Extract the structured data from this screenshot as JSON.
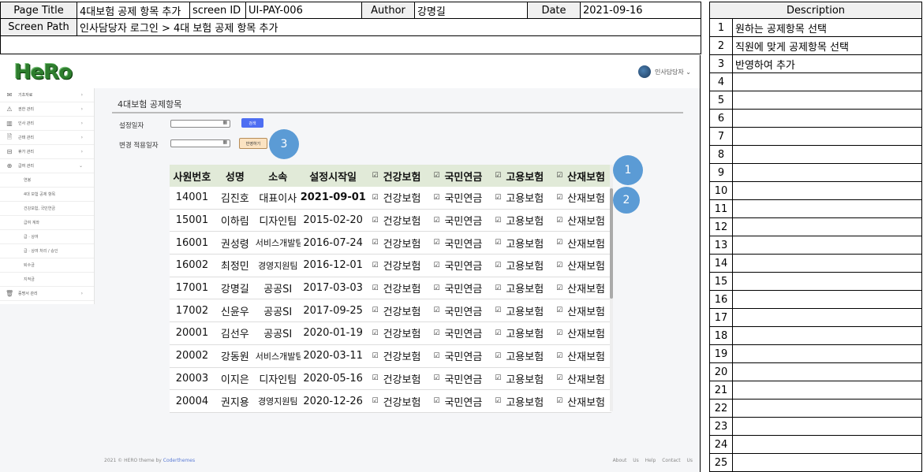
{
  "spec": {
    "page_title_label": "Page Title",
    "page_title": "4대보험 공제 항목 추가",
    "screen_id_label": "screen ID",
    "screen_id": "UI-PAY-006",
    "author_label": "Author",
    "author": "강명길",
    "date_label": "Date",
    "date": "2021-09-16",
    "screen_path_label": "Screen Path",
    "screen_path": "인사담당자 로그인 > 4대 보험 공제 항목 추가"
  },
  "description": {
    "title": "Description",
    "rows": [
      {
        "num": "1",
        "text": "원하는 공제항목 선택"
      },
      {
        "num": "2",
        "text": "직원에 맞게 공제항목 선택"
      },
      {
        "num": "3",
        "text": "반영하여 추가"
      },
      {
        "num": "4",
        "text": ""
      },
      {
        "num": "5",
        "text": ""
      },
      {
        "num": "6",
        "text": ""
      },
      {
        "num": "7",
        "text": ""
      },
      {
        "num": "8",
        "text": ""
      },
      {
        "num": "9",
        "text": ""
      },
      {
        "num": "10",
        "text": ""
      },
      {
        "num": "11",
        "text": ""
      },
      {
        "num": "12",
        "text": ""
      },
      {
        "num": "13",
        "text": ""
      },
      {
        "num": "14",
        "text": ""
      },
      {
        "num": "15",
        "text": ""
      },
      {
        "num": "16",
        "text": ""
      },
      {
        "num": "17",
        "text": ""
      },
      {
        "num": "18",
        "text": ""
      },
      {
        "num": "19",
        "text": ""
      },
      {
        "num": "20",
        "text": ""
      },
      {
        "num": "21",
        "text": ""
      },
      {
        "num": "22",
        "text": ""
      },
      {
        "num": "23",
        "text": ""
      },
      {
        "num": "24",
        "text": ""
      },
      {
        "num": "25",
        "text": ""
      }
    ]
  },
  "app": {
    "logo": "HeRo",
    "user_label": "인사담당자 ⌄",
    "sidebar": [
      {
        "icon": "✉",
        "icon_name": "mail-icon",
        "label": "기초자료",
        "arrow": "›"
      },
      {
        "icon": "⚠",
        "icon_name": "warning-icon",
        "label": "권한 관리",
        "arrow": "›"
      },
      {
        "icon": "▥",
        "icon_name": "building-icon",
        "label": "인사 관리",
        "arrow": "›"
      },
      {
        "icon": "🗎",
        "icon_name": "document-icon",
        "label": "근태 관리",
        "arrow": "›"
      },
      {
        "icon": "⊟",
        "icon_name": "bookmark-icon",
        "label": "휴가 관리",
        "arrow": "›"
      },
      {
        "icon": "⊕",
        "icon_name": "payroll-icon",
        "label": "급여 관리",
        "arrow": "⌄"
      }
    ],
    "sidebar_sub": [
      "연봉",
      "4대 보험 공제 항목",
      "건강보험, 국민연금",
      "급여 계좌",
      "급 · 상여",
      "급 · 상여 처리 / 승인",
      "퇴수금",
      "지적금"
    ],
    "sidebar_last": {
      "icon": "🗑",
      "icon_name": "trash-icon",
      "label": "증명서 관리",
      "arrow": "›"
    },
    "page_heading": "4대보험 공제항목",
    "setting_date_label": "설정일자",
    "apply_date_label": "변경 적용일자",
    "calendar_glyph": "▦",
    "search_button": "검색",
    "apply_button": "반영하기",
    "footer_left": "2021 © HERO theme by ",
    "footer_left_link": "Coderthemes",
    "footer_right": "About Us   Help   Contact Us"
  },
  "callouts": [
    "1",
    "2",
    "3"
  ],
  "table": {
    "headers": [
      "사원번호",
      "성명",
      "소속",
      "설정시작일",
      "건강보험",
      "국민연금",
      "고용보험",
      "산재보험"
    ],
    "check_glyph": "☑",
    "rows": [
      {
        "id": "14001",
        "name": "김진호",
        "dept": "대표이사",
        "start": "2021-09-01",
        "ins": [
          "건강보험",
          "국민연금",
          "고용보험",
          "산재보험"
        ]
      },
      {
        "id": "15001",
        "name": "이하림",
        "dept": "디자인팀",
        "start": "2015-02-20",
        "ins": [
          "건강보험",
          "국민연금",
          "고용보험",
          "산재보험"
        ]
      },
      {
        "id": "16001",
        "name": "권성령",
        "dept": "서비스개발팀",
        "start": "2016-07-24",
        "ins": [
          "건강보험",
          "국민연금",
          "고용보험",
          "산재보험"
        ]
      },
      {
        "id": "16002",
        "name": "최정민",
        "dept": "경영지원팀",
        "start": "2016-12-01",
        "ins": [
          "건강보험",
          "국민연금",
          "고용보험",
          "산재보험"
        ]
      },
      {
        "id": "17001",
        "name": "강명길",
        "dept": "공공SI",
        "start": "2017-03-03",
        "ins": [
          "건강보험",
          "국민연금",
          "고용보험",
          "산재보험"
        ]
      },
      {
        "id": "17002",
        "name": "신윤우",
        "dept": "공공SI",
        "start": "2017-09-25",
        "ins": [
          "건강보험",
          "국민연금",
          "고용보험",
          "산재보험"
        ]
      },
      {
        "id": "20001",
        "name": "김선우",
        "dept": "공공SI",
        "start": "2020-01-19",
        "ins": [
          "건강보험",
          "국민연금",
          "고용보험",
          "산재보험"
        ]
      },
      {
        "id": "20002",
        "name": "강동원",
        "dept": "서비스개발팀",
        "start": "2020-03-11",
        "ins": [
          "건강보험",
          "국민연금",
          "고용보험",
          "산재보험"
        ]
      },
      {
        "id": "20003",
        "name": "이지은",
        "dept": "디자인팀",
        "start": "2020-05-16",
        "ins": [
          "건강보험",
          "국민연금",
          "고용보험",
          "산재보험"
        ]
      },
      {
        "id": "20004",
        "name": "권지용",
        "dept": "경영지원팀",
        "start": "2020-12-26",
        "ins": [
          "건강보험",
          "국민연금",
          "고용보험",
          "산재보험"
        ]
      }
    ]
  }
}
